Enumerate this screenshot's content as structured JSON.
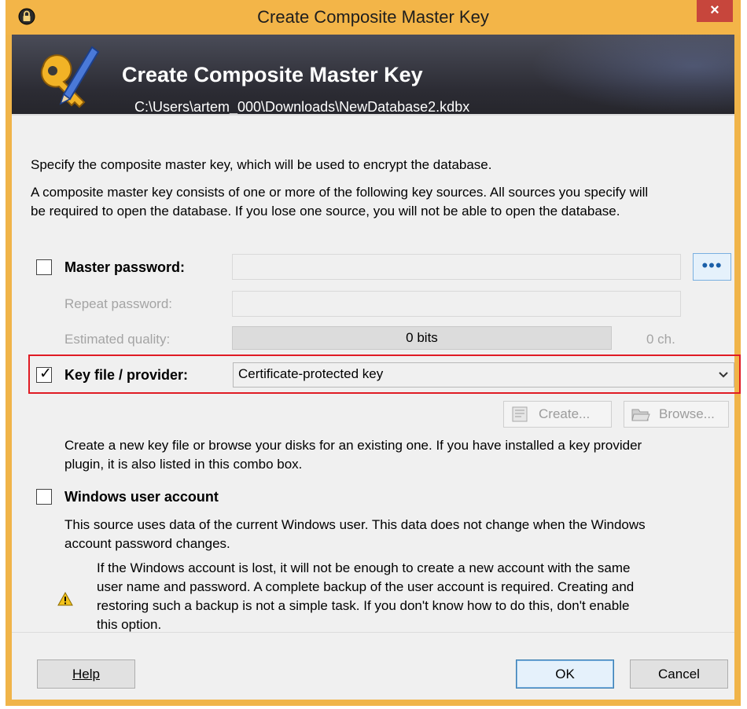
{
  "window": {
    "title": "Create Composite Master Key",
    "close_glyph": "×"
  },
  "banner": {
    "title": "Create Composite Master Key",
    "path": "C:\\Users\\artem_000\\Downloads\\NewDatabase2.kdbx",
    "icon": "key-pen-icon"
  },
  "intro": {
    "line1": "Specify the composite master key, which will be used to encrypt the database.",
    "line2a": "A composite master key consists of one or more of the following key sources. All sources you specify will",
    "line2b": "be required to open the database.  If you lose one source, you will not be able to open the database."
  },
  "master_password": {
    "label": "Master password:",
    "checked": false,
    "dots_glyph": "•••",
    "repeat_label": "Repeat password:",
    "quality_label": "Estimated quality:",
    "quality_value": "0 bits",
    "quality_chars": "0 ch."
  },
  "key_file": {
    "label": "Key file / provider:",
    "checked": true,
    "check_glyph": "✓",
    "selected": "Certificate-protected key",
    "create_label": "Create...",
    "browse_label": "Browse...",
    "help_a": "Create a new key file or browse your disks for an existing one. If you have installed a key provider",
    "help_b": "plugin, it is also listed in this combo box."
  },
  "windows_account": {
    "label": "Windows user account",
    "checked": false,
    "desc_a": "This source uses data of the current Windows user. This data does not change when the Windows",
    "desc_b": "account password changes.",
    "warn_1": "If the Windows account is lost, it will not be enough to create a new account with the same",
    "warn_2": "user name and password. A complete backup of the user account is required. Creating and",
    "warn_3": "restoring such a backup is not a simple task. If you don't know how to do this, don't enable",
    "warn_4": "this option."
  },
  "buttons": {
    "help": "Help",
    "ok": "OK",
    "cancel": "Cancel"
  },
  "colors": {
    "title_bar": "#f3b548",
    "close": "#c7463c",
    "highlight_border": "#e01b24",
    "banner_dark": "#2c2c34"
  }
}
